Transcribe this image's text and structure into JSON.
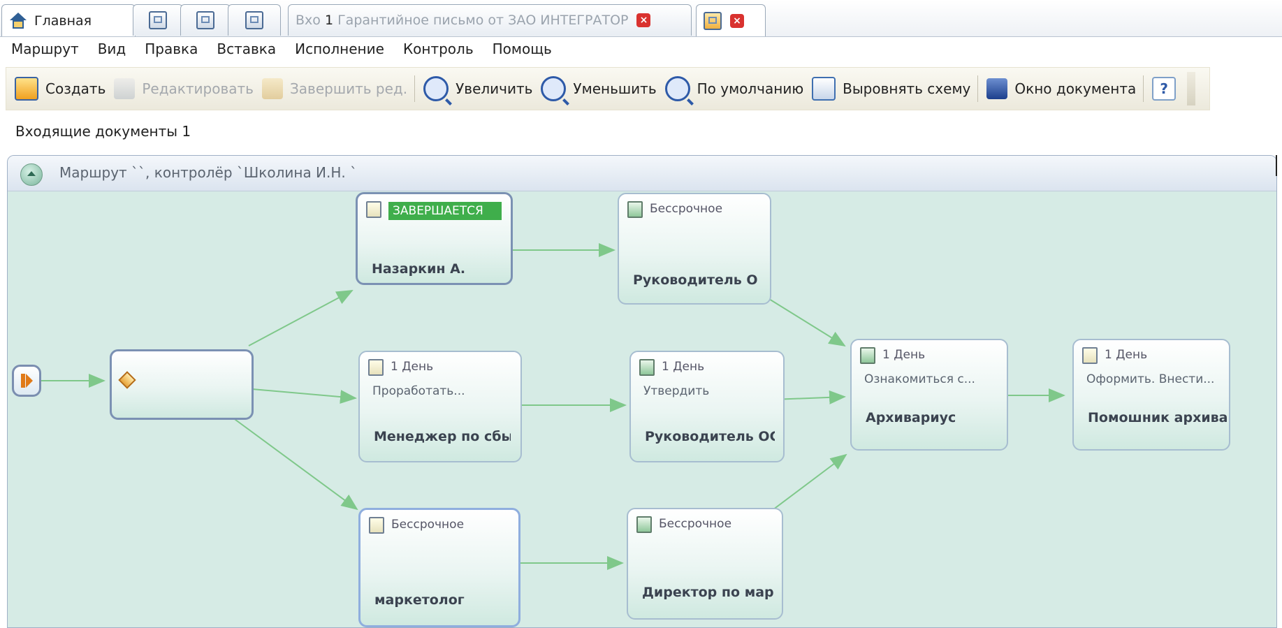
{
  "tabs": {
    "home": "Главная",
    "doc_prefix": "Вхо",
    "doc_number": "1",
    "doc_title": "Гарантийное письмо от ЗАО ИНТЕГРАТОР"
  },
  "menu": [
    "Маршрут",
    "Вид",
    "Правка",
    "Вставка",
    "Исполнение",
    "Контроль",
    "Помощь"
  ],
  "toolbar": {
    "create": "Создать",
    "edit": "Редактировать",
    "finish_edit": "Завершить ред.",
    "zoom_in": "Увеличить",
    "zoom_out": "Уменьшить",
    "zoom_default": "По умолчанию",
    "align": "Выровнять схему",
    "doc_window": "Окно документа"
  },
  "heading": "Входящие документы 1",
  "route_title": "Маршрут ``, контролёр `Школина И.Н. `",
  "nodes": [
    {
      "status": "ЗАВЕРШАЕТСЯ",
      "task": "",
      "name": "Назаркин А."
    },
    {
      "status": "Бессрочное",
      "task": "",
      "name": "Руководитель ОП"
    },
    {
      "status": "1 День",
      "task": "Проработать...",
      "name": "Менеджер по сбыту"
    },
    {
      "status": "1 День",
      "task": "Утвердить",
      "name": "Руководитель ОС"
    },
    {
      "status": "1 День",
      "task": "Ознакомиться с...",
      "name": "Архивариус"
    },
    {
      "status": "1 День",
      "task": "Оформить. Внести...",
      "name": "Помошник архивари"
    },
    {
      "status": "Бессрочное",
      "task": "",
      "name": "маркетолог"
    },
    {
      "status": "Бессрочное",
      "task": "",
      "name": "Директор по маркет"
    }
  ],
  "colors": {
    "panel_bg": "#d6ebe5",
    "edge": "#7fc88a",
    "status_active": "#3fae4b"
  }
}
